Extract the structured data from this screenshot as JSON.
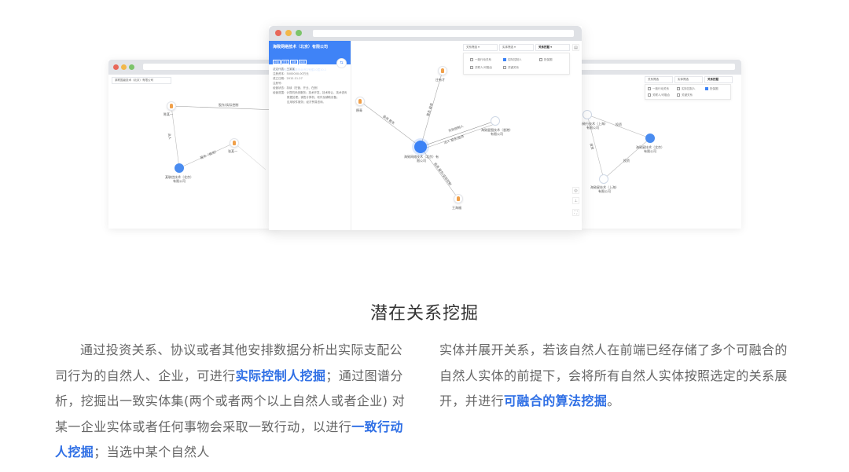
{
  "left_window": {
    "dropdown": "某联国级技术（北京）有限公司",
    "nodes": [
      {
        "label": "陈某一"
      },
      {
        "label": "张某一"
      },
      {
        "label": "某联信技术（北京）有限公司"
      }
    ],
    "edge_labels": [
      "股东/实际控制",
      "法人",
      "股东（投资）"
    ]
  },
  "main_window": {
    "company_panel": {
      "title": "海致网络技术（北京）有限公司",
      "tags": [
        "存续",
        "企业",
        "高新",
        "投资"
      ],
      "subtitle": "北京市海淀区知春路甲48号2号楼10层10-1",
      "rows": [
        "法定代表：王某某",
        "注册资本：5000000.00万元",
        "成立日期：2012-11-27",
        "注册号：",
        "经营状态：存续（在营、开业、在册）",
        "经营范围：计算机系统服务；技术开发、技术转让、技术咨询、技术服务；计算机系统集成；",
        "数据处理；销售计算机、软件及辅助设备；",
        "应用软件服务；经济贸易咨询。"
      ]
    },
    "filters": [
      "关系筛选",
      "实体筛选",
      "关系挖掘"
    ],
    "options": [
      {
        "label": "一致行动关系",
        "checked": false
      },
      {
        "label": "实际控制人",
        "checked": true
      },
      {
        "label": "担保圈",
        "checked": false
      },
      {
        "label": "关联人/可融合",
        "checked": false
      },
      {
        "label": "关键关系",
        "checked": false
      }
    ],
    "nodes": [
      {
        "label": "庄有才"
      },
      {
        "label": "穆青"
      },
      {
        "label": "海致网络技术（北京）有限公司"
      },
      {
        "label": "海致星图技术（香港）有限公司"
      },
      {
        "label": "王海福"
      }
    ],
    "edge_labels": [
      "投资 股东",
      "股东 投资",
      "实际控制人",
      "法人 股东/投资",
      "投资 股东/实际控制"
    ],
    "tools": [
      "◎",
      "⊥",
      "⛶"
    ],
    "comment_icon": "▤"
  },
  "right_window": {
    "filters": [
      "关系筛选",
      "实体筛选",
      "关系挖掘"
    ],
    "options": [
      "一致行动关系",
      "实际控制人",
      "担保圈",
      "关联人/可融合",
      "关键关系"
    ],
    "nodes": [
      {
        "label": "海致行技术（上海）有限公司"
      },
      {
        "label": "海致星技术（北京）有限公司"
      },
      {
        "label": "海致星技术（上海）有限公司"
      }
    ],
    "edge_labels": [
      "投资",
      "投资",
      "投资"
    ]
  },
  "section": {
    "heading": "潜在关系挖掘",
    "left_paragraph": {
      "p1": "通过投资关系、协议或者其他安排数据分析出实际支配公司行为的自然人、企业，可进行",
      "h1": "实际控制人挖掘",
      "p2": "；通过图谱分析，挖掘出一致实体集(两个或者两个以上自然人或者企业) 对某一企业实体或者任何事物会采取一致行动，以进行",
      "h2": "一致行动人挖掘",
      "p3": "；当选中某个自然人"
    },
    "right_paragraph": {
      "p1": "实体并展开关系，若该自然人在前端已经存储了多个可融合的自然人实体的前提下，会将所有自然人实体按照选定的关系展开，并进行",
      "h1": "可融合的算法挖掘",
      "p2": "。"
    }
  },
  "colors": {
    "accent": "#2f6fe5",
    "node_blue": "#3b82f6",
    "panel_blue": "#3f83f7",
    "person_orange": "#f0a04a",
    "window_bar": "#e2e4e8",
    "dot_red": "#e8685a",
    "dot_yellow": "#f2b84b",
    "dot_green": "#7cc46a"
  }
}
